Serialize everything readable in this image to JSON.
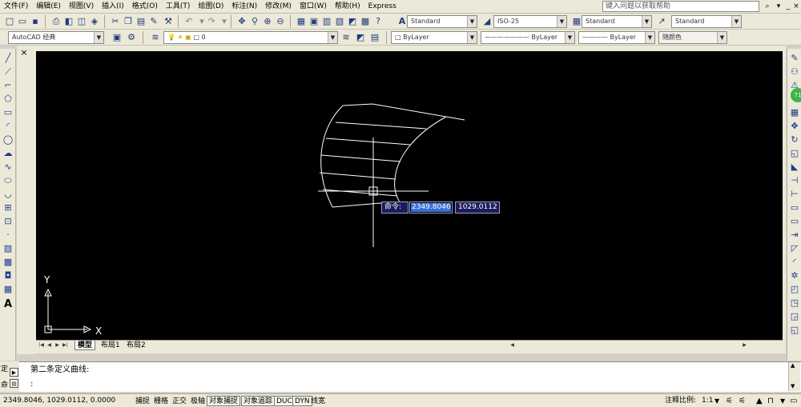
{
  "menu": [
    {
      "id": "file",
      "label": "文件(F)"
    },
    {
      "id": "edit",
      "label": "编辑(E)"
    },
    {
      "id": "view",
      "label": "视图(V)"
    },
    {
      "id": "insert",
      "label": "插入(I)"
    },
    {
      "id": "format",
      "label": "格式(O)"
    },
    {
      "id": "tools",
      "label": "工具(T)"
    },
    {
      "id": "draw",
      "label": "绘图(D)"
    },
    {
      "id": "dimension",
      "label": "标注(N)"
    },
    {
      "id": "modify",
      "label": "修改(M)"
    },
    {
      "id": "window",
      "label": "窗口(W)"
    },
    {
      "id": "help",
      "label": "帮助(H)"
    },
    {
      "id": "express",
      "label": "Express"
    }
  ],
  "help_search": {
    "placeholder": "键入问题以获取帮助"
  },
  "styles_toolbar": {
    "text_style": "Standard",
    "dim_style": "ISO-25",
    "table_style": "Standard",
    "multileader_style": "Standard"
  },
  "workspace": {
    "value": "AutoCAD 经典"
  },
  "layer": {
    "value": "0"
  },
  "properties": {
    "color": "ByLayer",
    "linetype": "ByLayer",
    "lineweight": "ByLayer",
    "plot_style": "随颜色"
  },
  "canvas": {
    "ucs_x_label": "X",
    "ucs_y_label": "Y",
    "tooltip_prompt": "命令:",
    "coord_x": "2349.8046",
    "coord_y": "1029.0112",
    "colors": {
      "background": "#000000",
      "lines": "#ffffff",
      "tooltip_bg": "#1a1a4a",
      "highlight": "#3a6fd8"
    }
  },
  "tabs": [
    {
      "id": "model",
      "label": "模型"
    },
    {
      "id": "layout1",
      "label": "布局1"
    },
    {
      "id": "layout2",
      "label": "布局2"
    }
  ],
  "command": {
    "side_label_top": "定",
    "side_label_bottom": "命",
    "history": "第二条定义曲线:",
    "prompt": ":"
  },
  "statusbar": {
    "coordinates": "2349.8046, 1029.0112, 0.0000",
    "toggles": [
      {
        "id": "snap",
        "label": "捕捉",
        "on": false
      },
      {
        "id": "grid",
        "label": "栅格",
        "on": false
      },
      {
        "id": "ortho",
        "label": "正交",
        "on": false
      },
      {
        "id": "polar",
        "label": "极轴",
        "on": false
      },
      {
        "id": "osnap",
        "label": "对象捕捉",
        "on": true
      },
      {
        "id": "otrack",
        "label": "对象追踪",
        "on": true
      },
      {
        "id": "ducs",
        "label": "DUCS",
        "on": true
      },
      {
        "id": "dyn",
        "label": "DYN",
        "on": true
      },
      {
        "id": "lwt",
        "label": "线宽",
        "on": false
      }
    ],
    "anno_scale_label": "注释比例:",
    "anno_scale_value": "1:1"
  },
  "badge": {
    "value": "71",
    "color": "#3db54a"
  }
}
